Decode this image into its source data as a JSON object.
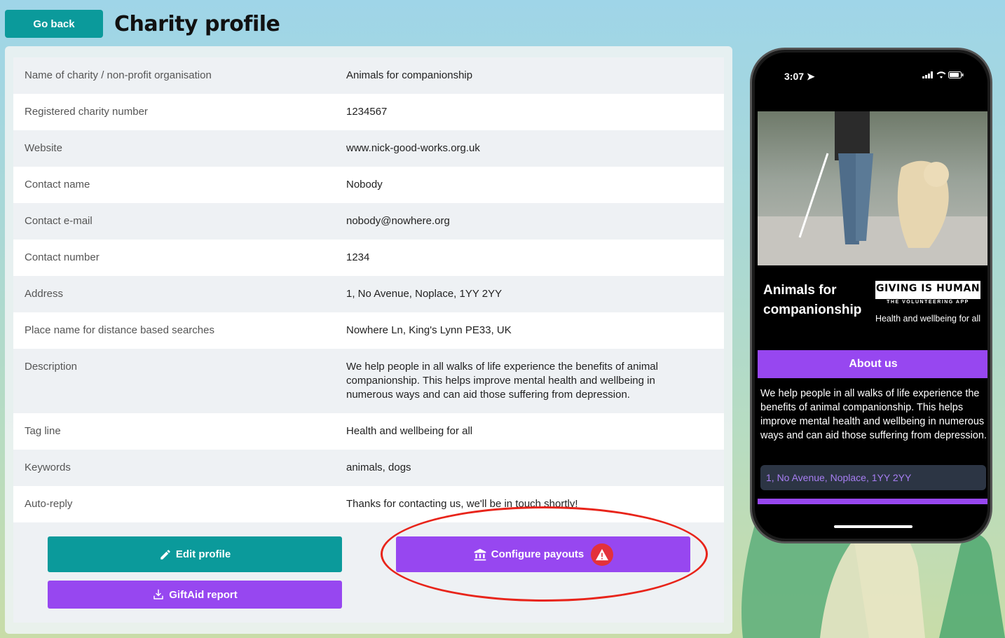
{
  "header": {
    "go_back_label": "Go back",
    "title": "Charity profile"
  },
  "profile": {
    "rows": [
      {
        "label": "Name of charity / non-profit organisation",
        "value": "Animals for companionship"
      },
      {
        "label": "Registered charity number",
        "value": "1234567"
      },
      {
        "label": "Website",
        "value": "www.nick-good-works.org.uk"
      },
      {
        "label": "Contact name",
        "value": "Nobody"
      },
      {
        "label": "Contact e-mail",
        "value": "nobody@nowhere.org"
      },
      {
        "label": "Contact number",
        "value": "1234"
      },
      {
        "label": "Address",
        "value": "1, No Avenue, Noplace, 1YY 2YY"
      },
      {
        "label": "Place name for distance based searches",
        "value": "Nowhere Ln, King's Lynn PE33, UK"
      },
      {
        "label": "Description",
        "value": "We help people in all walks of life experience the benefits of animal companionship. This helps improve mental health and wellbeing in numerous ways and can aid those suffering from depression."
      },
      {
        "label": "Tag line",
        "value": "Health and wellbeing for all"
      },
      {
        "label": "Keywords",
        "value": "animals, dogs"
      },
      {
        "label": "Auto-reply",
        "value": "Thanks for contacting us, we'll be in touch shortly!"
      }
    ]
  },
  "actions": {
    "edit_label": "Edit profile",
    "giftaid_label": "GiftAid report",
    "payouts_label": "Configure payouts"
  },
  "phone": {
    "time": "3:07",
    "charity_name": "Animals for companionship",
    "logo_top": "GIVING IS HUMAN",
    "logo_bottom": "THE VOLUNTEERING APP",
    "tagline": "Health and wellbeing for all",
    "about_label": "About us",
    "description": "We help people in all walks of life experience the benefits of animal companionship. This helps improve mental health and wellbeing in numerous ways and can aid those suffering from depression.",
    "address": "1, No Avenue, Noplace, 1YY 2YY"
  },
  "colors": {
    "teal": "#0b9a9b",
    "purple": "#9747f0",
    "warning_red": "#e3313b",
    "annotation_red": "#e8241a"
  }
}
